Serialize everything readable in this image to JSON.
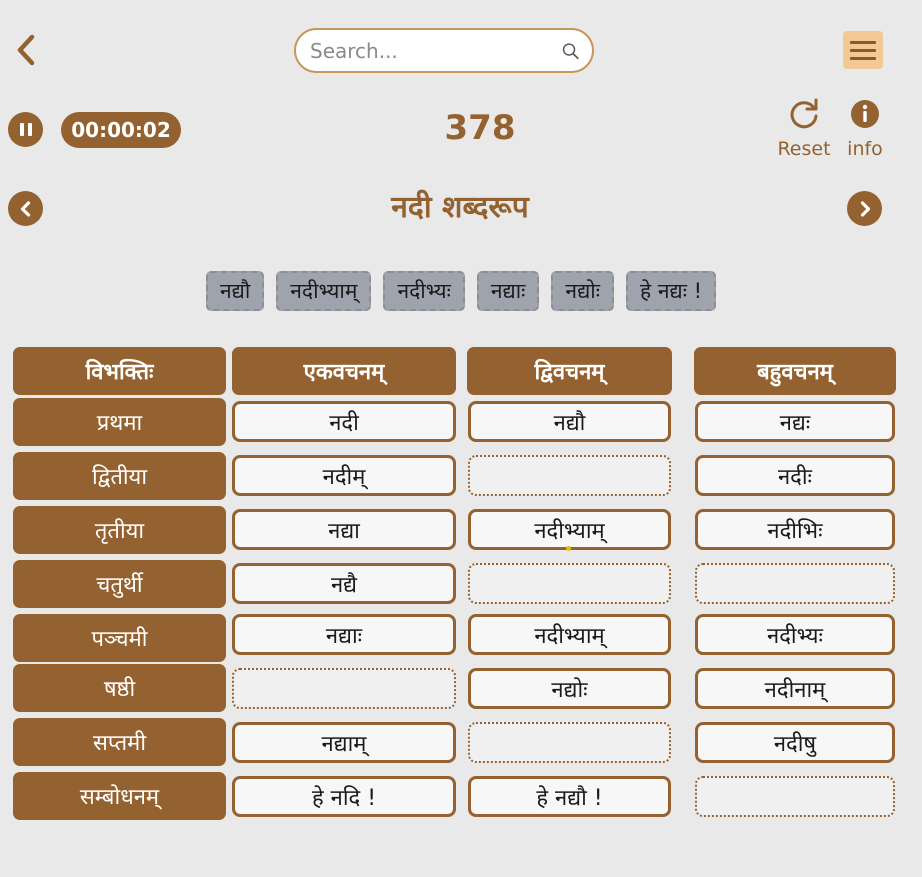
{
  "search": {
    "placeholder": "Search..."
  },
  "status": {
    "timer": "00:00:02",
    "counter": "378"
  },
  "tools": {
    "reset": "Reset",
    "info": "info"
  },
  "title": "नदी शब्दरूप",
  "options": [
    "नद्यौ",
    "नदीभ्याम्",
    "नदीभ्यः",
    "नद्याः",
    "नद्योः",
    "हे नद्यः !"
  ],
  "table": {
    "headers": [
      "विभक्तिः",
      "एकवचनम्",
      "द्विवचनम्",
      "बहुवचनम्"
    ],
    "rows": [
      {
        "label": "प्रथमा",
        "cells": [
          "नदी",
          "नद्यौ",
          "नद्यः"
        ]
      },
      {
        "label": "द्वितीया",
        "cells": [
          "नदीम्",
          "",
          "नदीः"
        ]
      },
      {
        "label": "तृतीया",
        "cells": [
          "नद्या",
          "नदीभ्याम्",
          "नदीभिः"
        ]
      },
      {
        "label": "चतुर्थी",
        "cells": [
          "नद्यै",
          "",
          ""
        ]
      },
      {
        "label": "पञ्चमी",
        "cells": [
          "नद्याः",
          "नदीभ्याम्",
          "नदीभ्यः"
        ]
      },
      {
        "label": "षष्ठी",
        "cells": [
          "",
          "नद्योः",
          "नदीनाम्"
        ]
      },
      {
        "label": "सप्तमी",
        "cells": [
          "नद्याम्",
          "",
          "नदीषु"
        ]
      },
      {
        "label": "सम्बोधनम्",
        "cells": [
          "हे नदि !",
          "हे नद्यौ !",
          ""
        ]
      }
    ]
  },
  "colors": {
    "brand": "#936230",
    "accent": "#f2c894",
    "background": "#e9e9e9",
    "chip": "#9fa3ad"
  },
  "icons": [
    "chevron-left-icon",
    "search-icon",
    "hamburger-menu-icon",
    "pause-icon",
    "reset-icon",
    "info-icon",
    "prev-circle-icon",
    "next-circle-icon"
  ]
}
